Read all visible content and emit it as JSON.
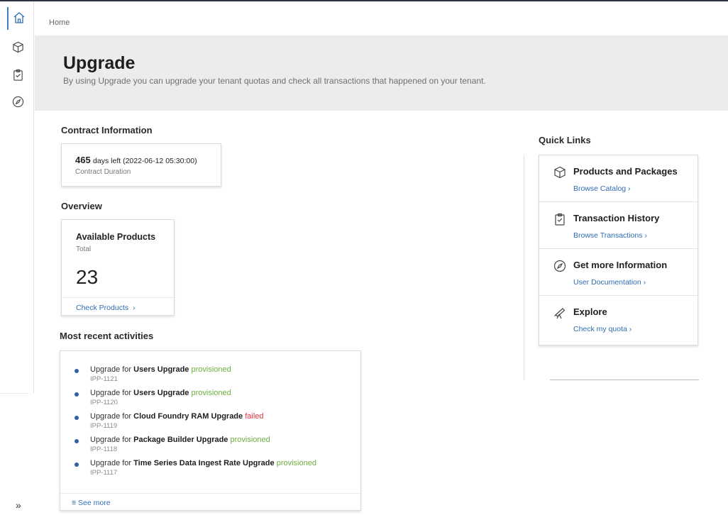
{
  "breadcrumb": "Home",
  "hero": {
    "title": "Upgrade",
    "subtitle": "By using Upgrade you can upgrade your tenant quotas and check all transactions that happened on your tenant."
  },
  "contract": {
    "section_title": "Contract Information",
    "days": "465",
    "days_suffix": "days left (2022-06-12 05:30:00)",
    "label": "Contract Duration"
  },
  "overview": {
    "section_title": "Overview",
    "card_title": "Available Products",
    "card_sub": "Total",
    "count": "23",
    "link": "Check Products"
  },
  "activities": {
    "section_title": "Most recent activities",
    "prefix": "Upgrade for",
    "items": [
      {
        "name": "Users Upgrade",
        "status": "provisioned",
        "id": "IPP-1121"
      },
      {
        "name": "Users Upgrade",
        "status": "provisioned",
        "id": "IPP-1120"
      },
      {
        "name": "Cloud Foundry RAM Upgrade",
        "status": "failed",
        "id": "IPP-1119"
      },
      {
        "name": "Package Builder Upgrade",
        "status": "provisioned",
        "id": "IPP-1118"
      },
      {
        "name": "Time Series Data Ingest Rate Upgrade",
        "status": "provisioned",
        "id": "IPP-1117"
      }
    ],
    "see_more": "See more"
  },
  "quick_links": {
    "section_title": "Quick Links",
    "items": [
      {
        "title": "Products and Packages",
        "link": "Browse Catalog",
        "icon": "box-icon"
      },
      {
        "title": "Transaction History",
        "link": "Browse Transactions",
        "icon": "clipboard-icon"
      },
      {
        "title": "Get more Information",
        "link": "User Documentation",
        "icon": "compass-icon"
      },
      {
        "title": "Explore",
        "link": "Check my quota",
        "icon": "telescope-icon"
      }
    ]
  },
  "colors": {
    "accent": "#2f6db3",
    "success": "#6cae3e",
    "error": "#d9363e",
    "hero_bg": "#ececec"
  }
}
